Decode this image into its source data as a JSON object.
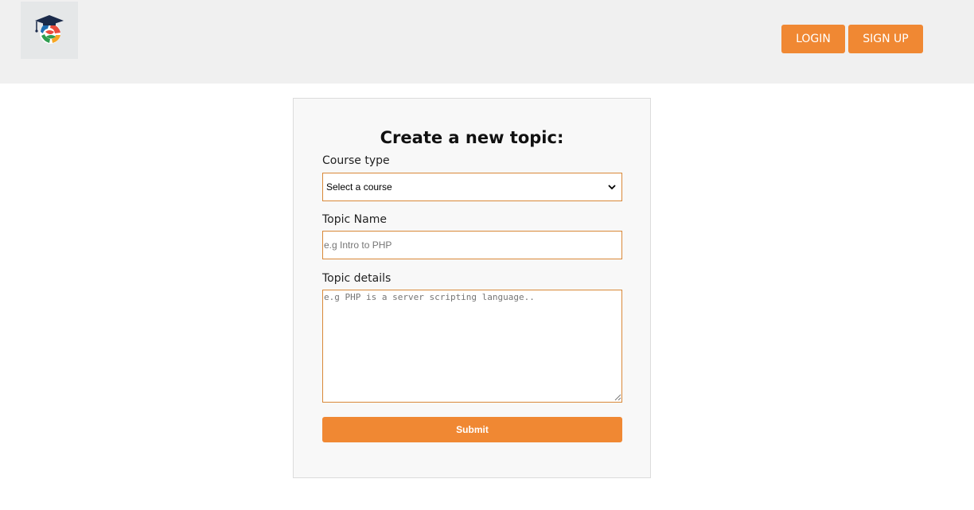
{
  "header": {
    "logo_icon": "graduation-cap-globe-icon",
    "login_label": "LOGIN",
    "signup_label": "SIGN UP"
  },
  "form": {
    "title": "Create a new topic:",
    "course_type_label": "Course type",
    "course_select_value": "Select a course",
    "topic_name_label": "Topic Name",
    "topic_name_placeholder": "e.g Intro to PHP",
    "topic_details_label": "Topic details",
    "topic_details_placeholder": "e.g PHP is a server scripting language..",
    "submit_label": "Submit"
  },
  "colors": {
    "accent": "#f08833",
    "header_bg": "#f0f0f0",
    "card_bg": "#f8f8f8",
    "input_border": "#d98838"
  }
}
